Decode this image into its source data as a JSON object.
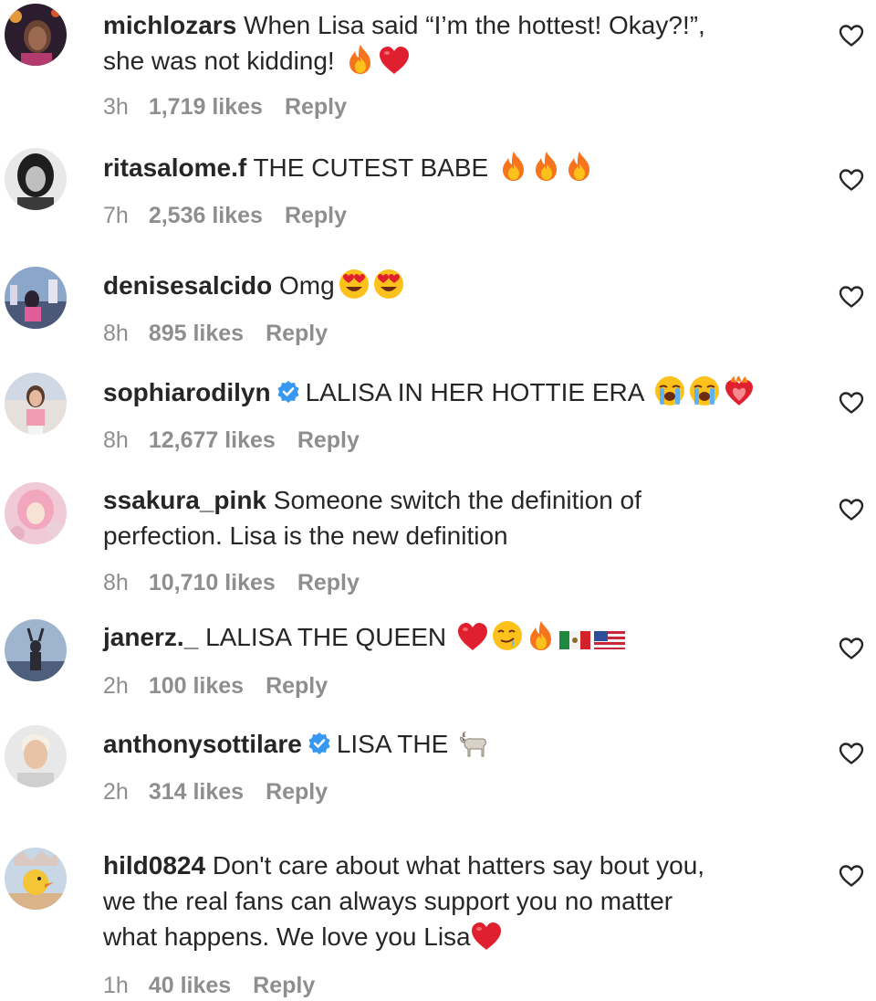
{
  "comments": [
    {
      "username": "michlozars",
      "text_before": "When Lisa said “I’m the hottest! Okay?!”,",
      "text_line2": "she was not kidding!",
      "emojis": [
        "fire-emoji",
        "red-heart-emoji"
      ],
      "time": "3h",
      "likes": "1,719 likes",
      "reply": "Reply",
      "avatar_color": "#2b1d2e"
    },
    {
      "username": "ritasalome.f",
      "text": "THE CUTEST BABE",
      "emojis": [
        "fire-emoji",
        "fire-emoji",
        "fire-emoji"
      ],
      "time": "7h",
      "likes": "2,536 likes",
      "reply": "Reply",
      "avatar_color": "#555555"
    },
    {
      "username": "denisesalcido",
      "text": "Omg",
      "emojis": [
        "heart-eyes-emoji",
        "heart-eyes-emoji"
      ],
      "time": "8h",
      "likes": "895 likes",
      "reply": "Reply",
      "avatar_color": "#8aa6c8"
    },
    {
      "username": "sophiarodilyn",
      "verified": true,
      "text": "LALISA IN HER HOTTIE ERA",
      "emojis": [
        "loudly-crying-emoji",
        "loudly-crying-emoji",
        "heart-on-fire-emoji"
      ],
      "time": "8h",
      "likes": "12,677 likes",
      "reply": "Reply",
      "avatar_color": "#d9c7c0"
    },
    {
      "username": "ssakura_pink",
      "text": "Someone switch the definition of",
      "text_line2": "perfection. Lisa is the new definition",
      "time": "8h",
      "likes": "10,710 likes",
      "reply": "Reply",
      "avatar_color": "#e9b8c6"
    },
    {
      "username": "janerz._",
      "text": "LALISA THE QUEEN",
      "emojis": [
        "red-heart-emoji",
        "drooling-face-emoji",
        "fire-emoji",
        "mexico-flag-emoji",
        "us-flag-emoji"
      ],
      "time": "2h",
      "likes": "100 likes",
      "reply": "Reply",
      "avatar_color": "#6d86a8"
    },
    {
      "username": "anthonysottilare",
      "verified": true,
      "text": "LISA THE",
      "emojis": [
        "goat-emoji"
      ],
      "time": "2h",
      "likes": "314 likes",
      "reply": "Reply",
      "avatar_color": "#dedede"
    },
    {
      "username": "hild0824",
      "text": "Don't care about what hatters say bout you,",
      "text_line2": "we the real fans can always support you no matter",
      "text_line3": "what happens. We love you Lisa",
      "emojis": [
        "red-heart-emoji"
      ],
      "time": "1h",
      "likes": "40 likes",
      "reply": "Reply",
      "avatar_color": "#c7d7e6"
    }
  ],
  "colors": {
    "text": "#262626",
    "meta": "#8e8e8e",
    "verified_blue": "#3897f0",
    "heart_red": "#e0202e",
    "fire_orange": "#f77e1a"
  }
}
